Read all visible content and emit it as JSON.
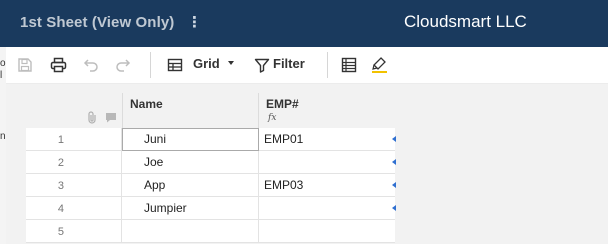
{
  "header": {
    "sheet_title": "1st Sheet (View Only)",
    "menu_glyph": "⋮",
    "company": "Cloudsmart LLC",
    "bg_color": "#1a3a5e"
  },
  "left_strip": {
    "chars": [
      "o",
      "l",
      "n"
    ]
  },
  "toolbar": {
    "grid_label": "Grid",
    "filter_label": "Filter",
    "icons": [
      "save-icon",
      "print-icon",
      "undo-icon",
      "redo-icon",
      "grid-view-icon",
      "filter-icon",
      "card-view-icon",
      "highlight-icon"
    ],
    "highlight_color": "#f2c200"
  },
  "columns": {
    "name": "Name",
    "emp": "EMP#",
    "emp_formula_glyph": "fx"
  },
  "rows": [
    {
      "num": "1",
      "name": "Juni",
      "emp": "EMP01"
    },
    {
      "num": "2",
      "name": "Joe",
      "emp": ""
    },
    {
      "num": "3",
      "name": "App",
      "emp": "EMP03"
    },
    {
      "num": "4",
      "name": "Jumpier",
      "emp": ""
    },
    {
      "num": "5",
      "name": "",
      "emp": ""
    }
  ]
}
